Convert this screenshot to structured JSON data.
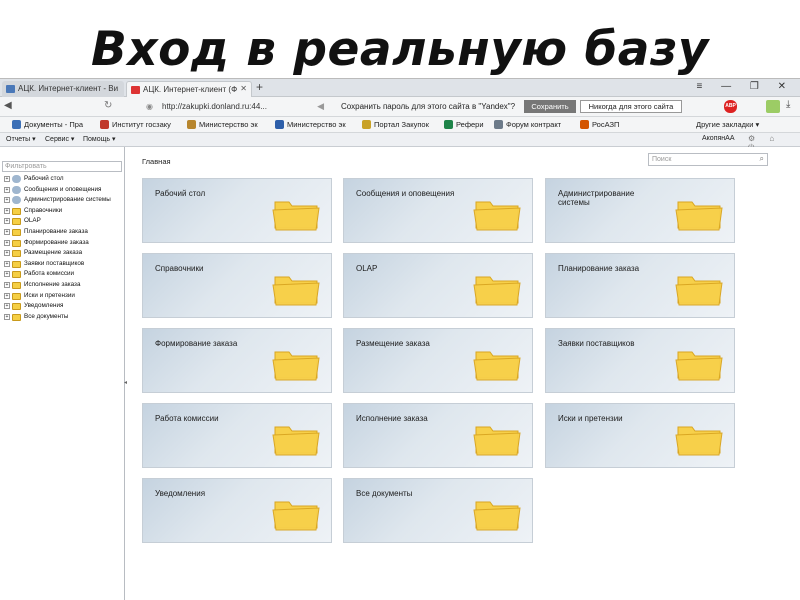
{
  "slide": {
    "title": "Вход в реальную базу"
  },
  "browser": {
    "tabs": [
      {
        "label": "АЦК. Интернет-клиент - Ви"
      },
      {
        "label": "АЦК. Интернет-клиент (Ф"
      }
    ],
    "new_tab": "+",
    "window_controls": "≡ — ❐ ✕",
    "url": "http://zakupki.donland.ru:44...",
    "password_prompt": "Сохранить пароль для этого сайта в \"Yandex\"?",
    "save_button": "Сохранить",
    "never_button": "Никогда для этого сайта",
    "abp_label": "ABP",
    "bookmarks": [
      {
        "label": "Документы - Пра",
        "color": "#3b6fb6"
      },
      {
        "label": "Институт госзаку",
        "color": "#c0392b"
      },
      {
        "label": "Министерство эк",
        "color": "#b7862e"
      },
      {
        "label": "Министерство эк",
        "color": "#2d5faa"
      },
      {
        "label": "Портал Закупок",
        "color": "#c9a227"
      },
      {
        "label": "Рефери",
        "color": "#1e8449"
      },
      {
        "label": "Форум контракт",
        "color": "#6c7a89"
      },
      {
        "label": "РосАЗП",
        "color": "#d35400"
      }
    ],
    "other_bookmarks": "Другие закладки ▾"
  },
  "app": {
    "menu": [
      {
        "label": "Отчеты ▾"
      },
      {
        "label": "Сервис ▾"
      },
      {
        "label": "Помощь ▾"
      }
    ],
    "user": "АкопянАА",
    "filter_placeholder": "Фильтровать",
    "tree": [
      {
        "label": "Рабочий стол",
        "icon": "desk-icon"
      },
      {
        "label": "Сообщения и оповещения",
        "icon": "messages-icon"
      },
      {
        "label": "Администрирование системы",
        "icon": "admin-icon"
      },
      {
        "label": "Справочники",
        "icon": "folder-icon"
      },
      {
        "label": "OLAP",
        "icon": "folder-icon"
      },
      {
        "label": "Планирование заказа",
        "icon": "folder-icon"
      },
      {
        "label": "Формирование заказа",
        "icon": "folder-icon"
      },
      {
        "label": "Размещение заказа",
        "icon": "folder-icon"
      },
      {
        "label": "Заявки поставщиков",
        "icon": "folder-icon"
      },
      {
        "label": "Работа комиссии",
        "icon": "folder-icon"
      },
      {
        "label": "Исполнение заказа",
        "icon": "folder-icon"
      },
      {
        "label": "Иски и претензии",
        "icon": "folder-icon"
      },
      {
        "label": "Уведомления",
        "icon": "folder-icon"
      },
      {
        "label": "Все документы",
        "icon": "folder-icon"
      }
    ],
    "breadcrumb": "Главная",
    "search_placeholder": "Поиск",
    "tiles": [
      {
        "label": "Рабочий стол"
      },
      {
        "label": "Сообщения и оповещения"
      },
      {
        "label": "Администрирование системы"
      },
      {
        "label": "Справочники"
      },
      {
        "label": "OLAP"
      },
      {
        "label": "Планирование заказа"
      },
      {
        "label": "Формирование заказа"
      },
      {
        "label": "Размещение заказа"
      },
      {
        "label": "Заявки поставщиков"
      },
      {
        "label": "Работа комиссии"
      },
      {
        "label": "Исполнение заказа"
      },
      {
        "label": "Иски и претензии"
      },
      {
        "label": "Уведомления"
      },
      {
        "label": "Все документы"
      }
    ]
  },
  "colors": {
    "folder_fill": "#f7d04a",
    "folder_edge": "#d9a521",
    "tile_bg": "#dde6ee",
    "save_button": "#777777"
  }
}
